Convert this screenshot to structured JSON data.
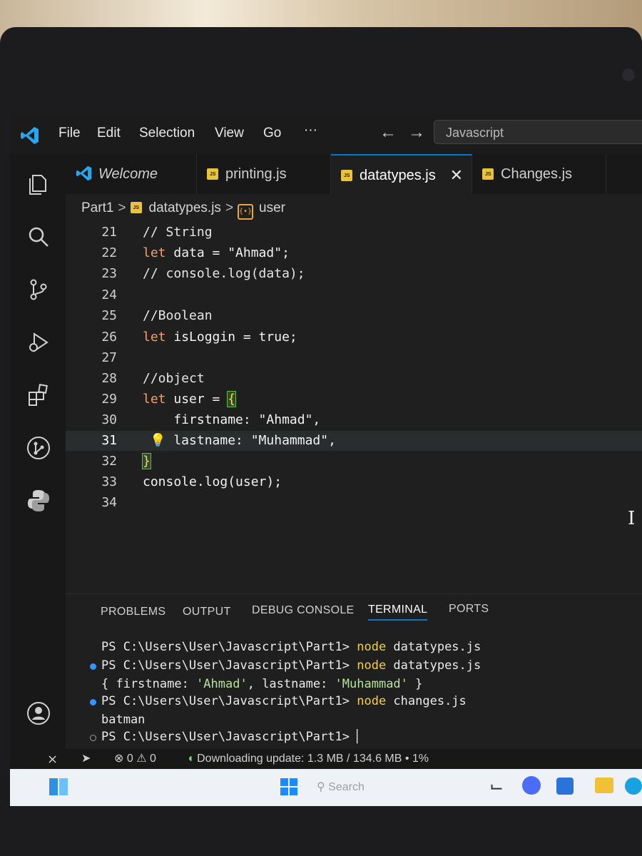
{
  "colors": {
    "accent": "#0078d4",
    "keyword": "#f0a070",
    "terminal_command": "#f2d045",
    "terminal_string": "#b6e39c"
  },
  "menu": {
    "file": "File",
    "edit": "Edit",
    "selection": "Selection",
    "view": "View",
    "go": "Go",
    "more": "···"
  },
  "search": {
    "text": "Javascript"
  },
  "tabs": [
    {
      "label": "Welcome",
      "icon": "vscode-icon"
    },
    {
      "label": "printing.js",
      "icon": "js-file-icon"
    },
    {
      "label": "datatypes.js",
      "icon": "js-file-icon",
      "active": true
    },
    {
      "label": "Changes.js",
      "icon": "js-file-icon"
    }
  ],
  "tab_close": "✕",
  "breadcrumb": {
    "folder": "Part1",
    "file": "datatypes.js",
    "symbol": "user",
    "symbol_icon": "{•}",
    "sep": ">"
  },
  "editor": {
    "lines": [
      {
        "num": "21",
        "code": "// String"
      },
      {
        "num": "22",
        "kw": "let",
        "rest": " data = \"Ahmad\";"
      },
      {
        "num": "23",
        "code": "// console.log(data);"
      },
      {
        "num": "24",
        "code": ""
      },
      {
        "num": "25",
        "code": "//Boolean"
      },
      {
        "num": "26",
        "kw": "let",
        "rest": " isLoggin = true;"
      },
      {
        "num": "27",
        "code": ""
      },
      {
        "num": "28",
        "code": "//object"
      },
      {
        "num": "29",
        "kw": "let",
        "rest": " user = ",
        "brace": "{"
      },
      {
        "num": "30",
        "code": "    firstname: \"Ahmad\","
      },
      {
        "num": "31",
        "code": "    lastname: \"Muhammad\","
      },
      {
        "num": "32",
        "brace": "}"
      },
      {
        "num": "33",
        "code": "console.log(user);"
      },
      {
        "num": "34",
        "code": ""
      }
    ],
    "bulb": "💡",
    "ibeam": "I"
  },
  "panel": {
    "tabs": [
      "PROBLEMS",
      "OUTPUT",
      "DEBUG CONSOLE",
      "TERMINAL",
      "PORTS"
    ],
    "active": "TERMINAL"
  },
  "terminal": {
    "prompt": "PS C:\\Users\\User\\Javascript\\Part1> ",
    "node": "node",
    "cmd1": " datatypes.js",
    "cmd2": " datatypes.js",
    "out_open": "{ firstname: ",
    "out_v1": "'Ahmad'",
    "out_mid": ", lastname: ",
    "out_v2": "'Muhammad'",
    "out_close": " }",
    "cmd3": " changes.js",
    "out2": "batman",
    "cursor": "▏"
  },
  "statusbar": {
    "errors": "0",
    "warnings": "0",
    "update": "Downloading update: 1.3 MB / 134.6 MB • 1%"
  },
  "taskbar": {
    "search_placeholder": "Search"
  }
}
